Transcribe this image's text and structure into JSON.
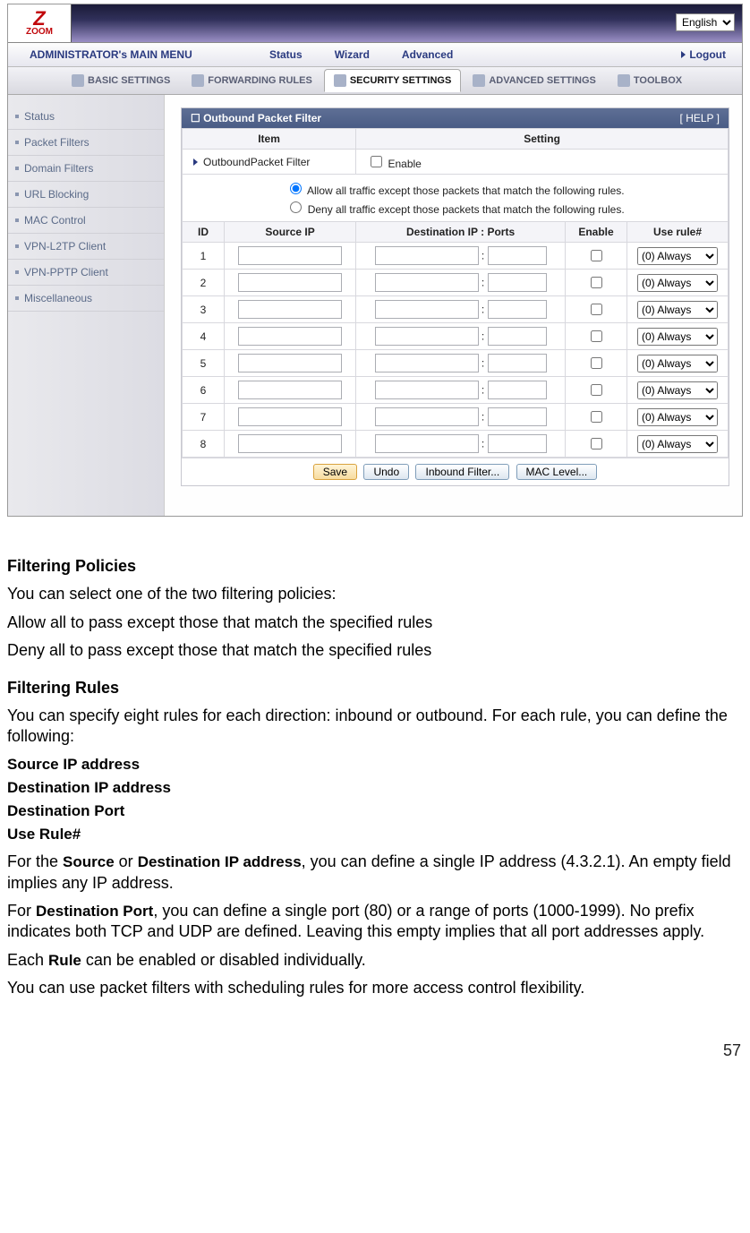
{
  "lang_select": "English",
  "main_nav": {
    "title": "ADMINISTRATOR's MAIN MENU",
    "items": [
      "Status",
      "Wizard",
      "Advanced"
    ],
    "logout": "Logout"
  },
  "tabs": [
    "BASIC SETTINGS",
    "FORWARDING RULES",
    "SECURITY SETTINGS",
    "ADVANCED SETTINGS",
    "TOOLBOX"
  ],
  "active_tab_index": 2,
  "sidebar": {
    "items": [
      "Status",
      "Packet Filters",
      "Domain Filters",
      "URL Blocking",
      "MAC Control",
      "VPN-L2TP Client",
      "VPN-PPTP Client",
      "Miscellaneous"
    ]
  },
  "panel": {
    "title": "Outbound Packet Filter",
    "help": "[ HELP ]",
    "col_item": "Item",
    "col_setting": "Setting",
    "row_main_label": "OutboundPacket Filter",
    "row_main_setting": "Enable",
    "radio_allow": "Allow all traffic except those packets that match the following rules.",
    "radio_deny": "Deny all traffic except those packets that match the following rules.",
    "cols": [
      "ID",
      "Source IP",
      "Destination IP : Ports",
      "Enable",
      "Use rule#"
    ],
    "rule_option": "(0) Always",
    "row_ids": [
      "1",
      "2",
      "3",
      "4",
      "5",
      "6",
      "7",
      "8"
    ],
    "buttons": {
      "save": "Save",
      "undo": "Undo",
      "inbound": "Inbound Filter...",
      "mac": "MAC Level..."
    }
  },
  "doc": {
    "h_policies": "Filtering Policies",
    "p1": "You can select one of the two filtering policies:",
    "p2": "Allow all to pass except those that match the specified rules",
    "p3": "Deny all to pass except those that match the specified rules",
    "h_rules": "Filtering Rules",
    "p4": "You can specify eight rules for each direction: inbound or outbound. For each rule, you can define the following:",
    "def1": "Source IP address",
    "def2": "Destination IP address",
    "def3": "Destination Port",
    "def4": "Use Rule#",
    "p5a": "For the ",
    "p5b": "Source",
    "p5c": " or ",
    "p5d": "Destination IP address",
    "p5e": ", you can define a single IP address (4.3.2.1). An empty field implies any IP address.",
    "p6a": "For ",
    "p6b": "Destination Port",
    "p6c": ", you can define a single port (80) or a range of ports (1000-1999). No prefix indicates both TCP and UDP are defined. Leaving this empty implies that all port addresses apply.",
    "p7a": "Each ",
    "p7b": "Rule",
    "p7c": " can be enabled or disabled individually.",
    "p8": "You can use packet filters with scheduling rules for more access control flexibility.",
    "page_num": "57"
  }
}
